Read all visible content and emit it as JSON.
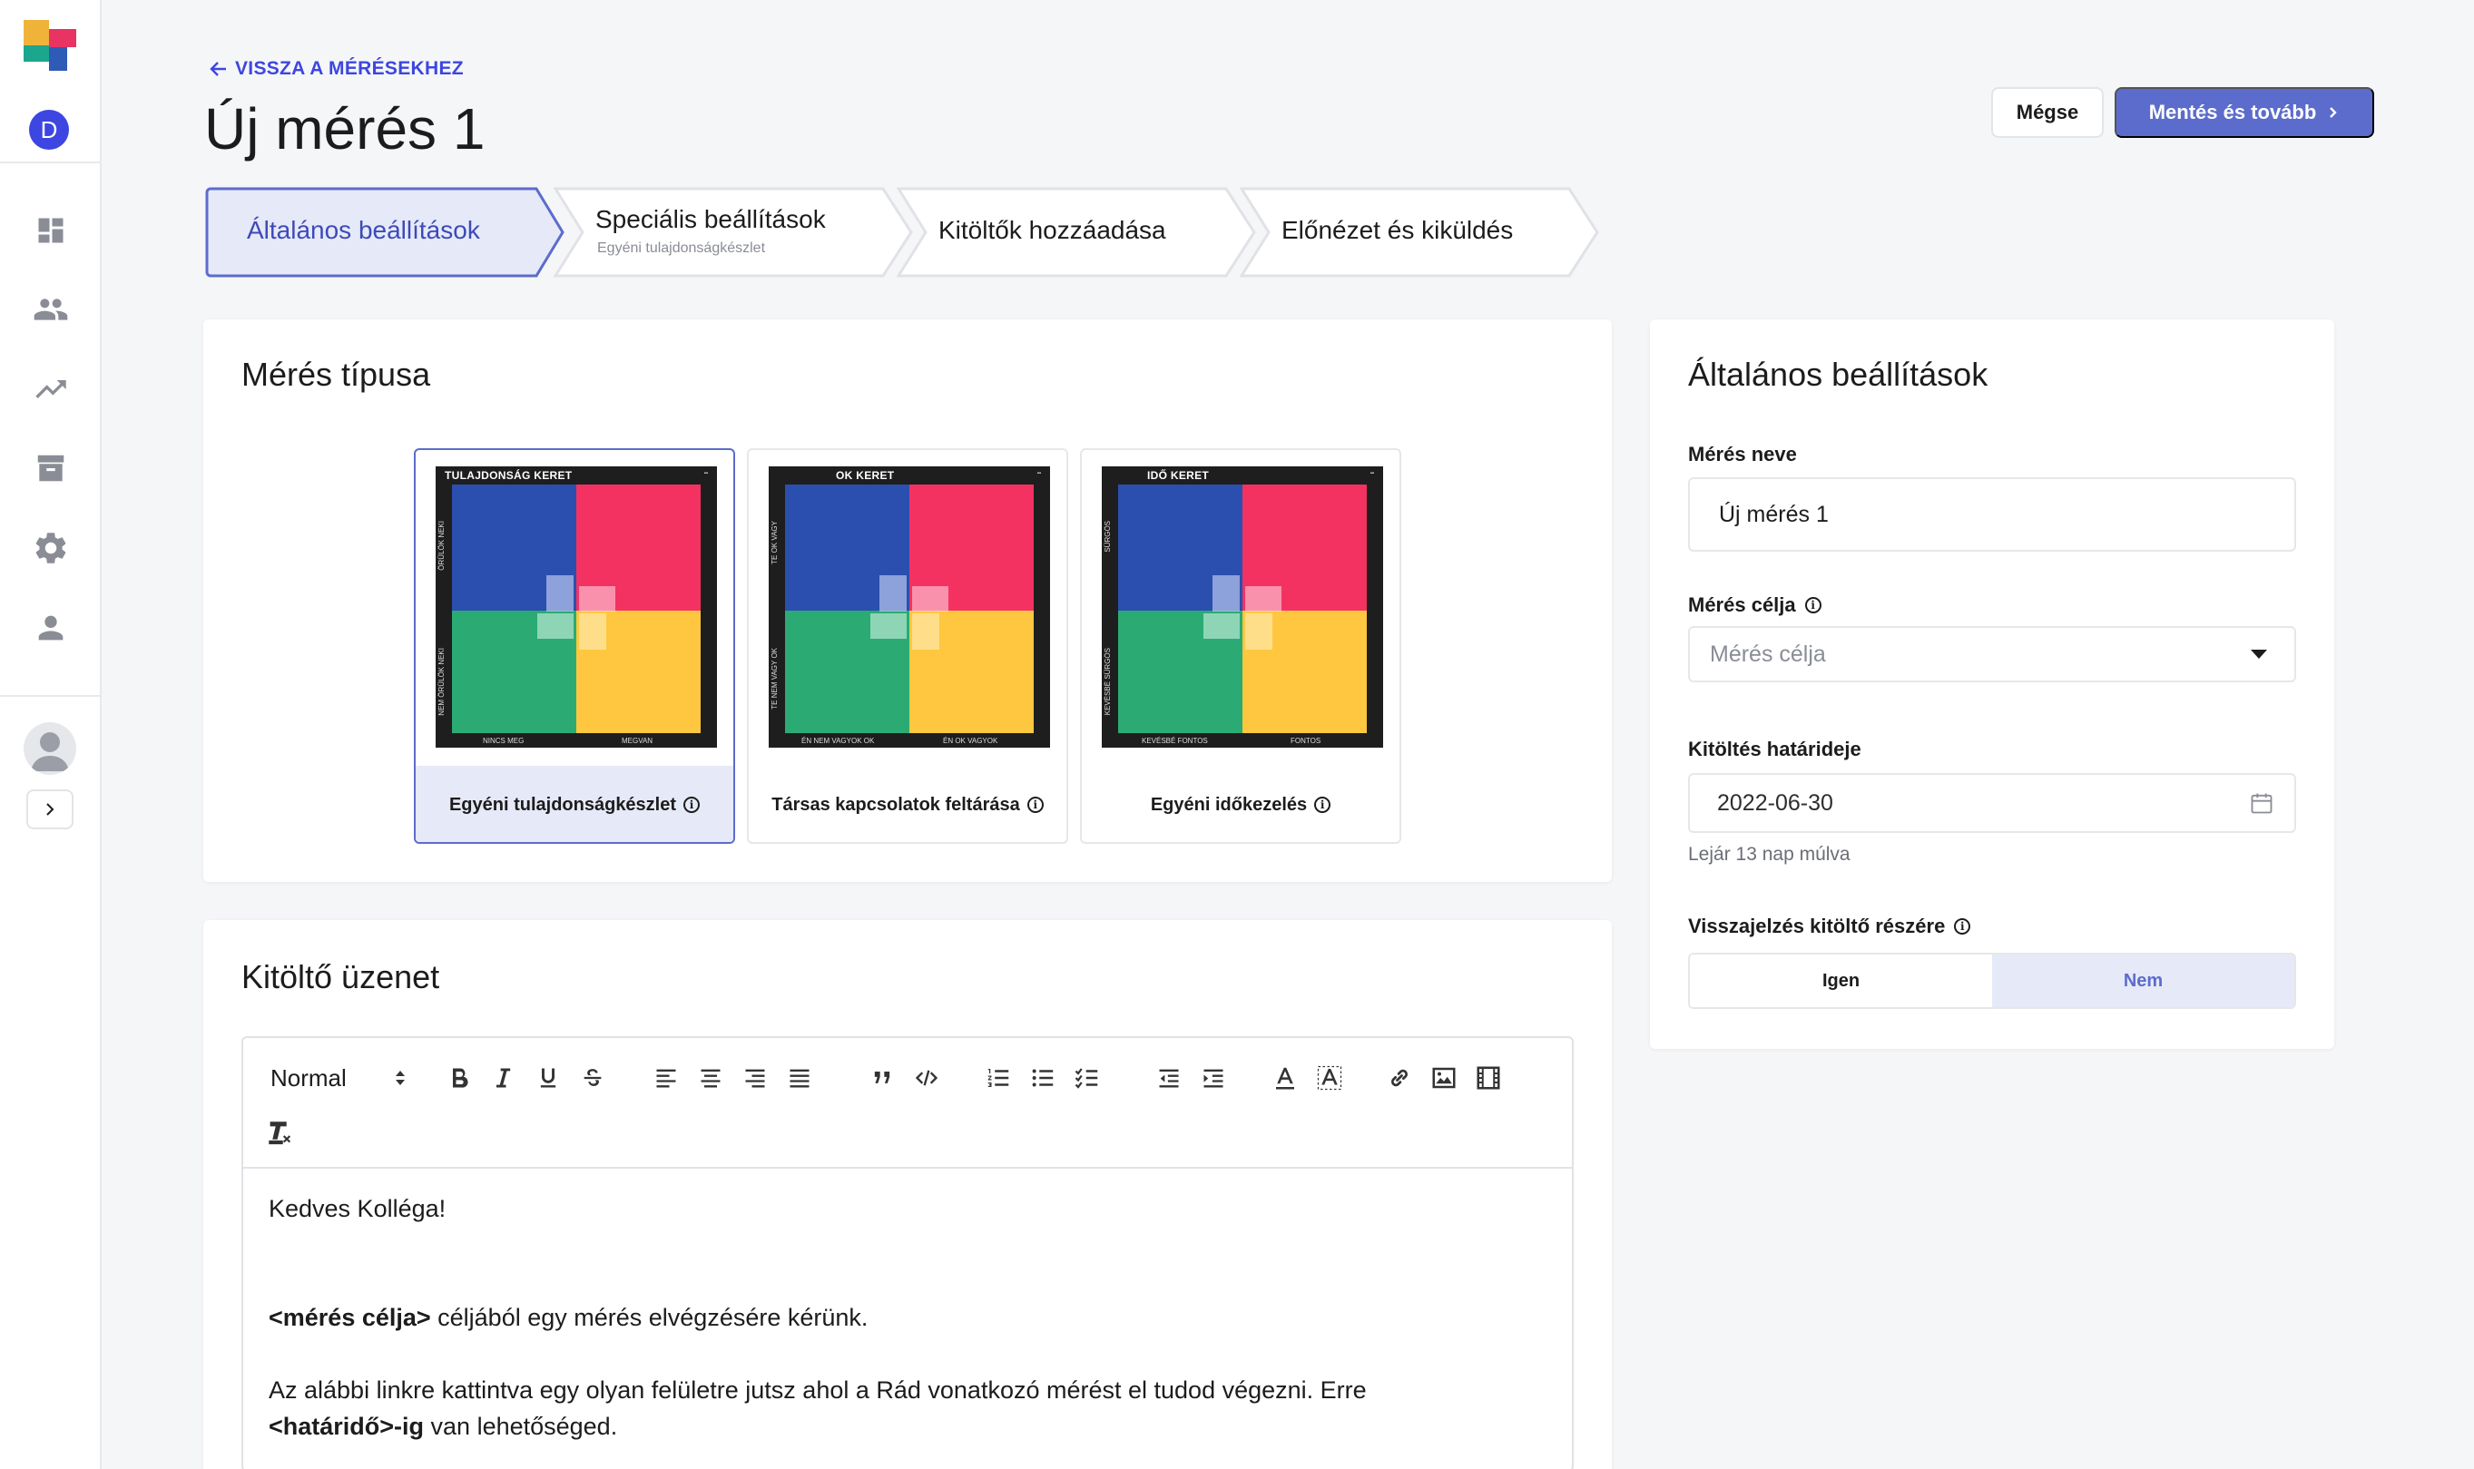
{
  "header": {
    "back_link": "VISSZA A MÉRÉSEKHEZ",
    "title": "Új mérés 1",
    "cancel_label": "Mégse",
    "save_label": "Mentés és tovább"
  },
  "sidebar": {
    "user_initial": "D",
    "items": [
      {
        "icon": "dashboard-icon"
      },
      {
        "icon": "people-icon"
      },
      {
        "icon": "trending-up-icon"
      },
      {
        "icon": "archive-icon"
      },
      {
        "icon": "gear-icon"
      },
      {
        "icon": "person-icon"
      }
    ]
  },
  "stepper": {
    "steps": [
      {
        "label": "Általános beállítások",
        "sub": "",
        "active": true
      },
      {
        "label": "Speciális beállítások",
        "sub": "Egyéni tulajdonságkészlet",
        "active": false
      },
      {
        "label": "Kitöltők hozzáadása",
        "sub": "",
        "active": false
      },
      {
        "label": "Előnézet és kiküldés",
        "sub": "",
        "active": false
      }
    ]
  },
  "measure_type": {
    "title": "Mérés típusa",
    "options": [
      {
        "caption": "Egyéni tulajdonságkészlet",
        "header": "TULAJDONSÁG KERET",
        "side_top": "ÖRÜLÖK NEKI",
        "side_bottom": "NEM ÖRÜLÖK NEKI",
        "foot_left": "NINCS MEG",
        "foot_right": "MEGVAN",
        "selected": true
      },
      {
        "caption": "Társas kapcsolatok feltárása",
        "header": "OK KERET",
        "side_top": "TE OK VAGY",
        "side_bottom": "TE NEM VAGY OK",
        "foot_left": "ÉN NEM VAGYOK OK",
        "foot_right": "ÉN OK VAGYOK",
        "selected": false
      },
      {
        "caption": "Egyéni időkezelés",
        "header": "IDŐ KERET",
        "side_top": "SÜRGŐS",
        "side_bottom": "KEVÉSBÉ SÜRGŐS",
        "foot_left": "KEVÉSBÉ FONTOS",
        "foot_right": "FONTOS",
        "selected": false
      }
    ],
    "colors": {
      "blue": "#2a4fae",
      "red": "#f33262",
      "green": "#2bab73",
      "yellow": "#fec73f"
    }
  },
  "message": {
    "title": "Kitöltő üzenet",
    "format_value": "Normal",
    "greeting": "Kedves Kolléga!",
    "line1_bold": "<mérés célja>",
    "line1_rest": " céljából egy mérés elvégzésére kérünk.",
    "line2_start": "Az alábbi linkre kattintva egy olyan felületre jutsz ahol a Rád vonatkozó mérést el tudod végezni. Erre",
    "line2_bold": "<határidő>-ig",
    "line2_rest": " van lehetőséged."
  },
  "general": {
    "title": "Általános beállítások",
    "name_label": "Mérés neve",
    "name_value": "Új mérés 1",
    "goal_label": "Mérés célja",
    "goal_placeholder": "Mérés célja",
    "deadline_label": "Kitöltés határideje",
    "deadline_value": "2022-06-30",
    "deadline_hint": "Lejár 13 nap múlva",
    "feedback_label": "Visszajelzés kitöltő részére",
    "feedback_yes": "Igen",
    "feedback_no": "Nem",
    "feedback_selected": "Nem"
  },
  "colors": {
    "accent": "#5c6ccc",
    "link": "#3d46e0",
    "selected_bg": "#e6e9f7"
  }
}
